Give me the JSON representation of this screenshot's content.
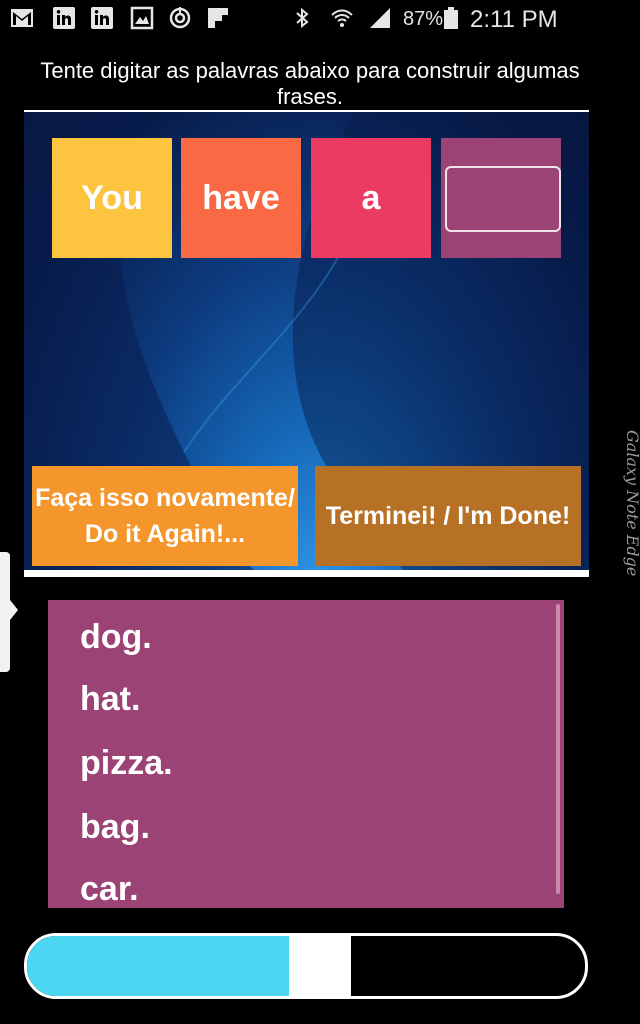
{
  "status_bar": {
    "icons_left": [
      "gmail-icon",
      "linkedin-icon",
      "linkedin-icon",
      "gallery-icon",
      "sync-icon",
      "flipboard-icon"
    ],
    "icons_right": [
      "bluetooth-icon",
      "wifi-icon",
      "signal-icon",
      "battery-icon"
    ],
    "battery": "87%",
    "time": "2:11 PM"
  },
  "instruction": "Tente digitar as palavras abaixo para construir algumas frases.",
  "sentence": {
    "words": [
      {
        "text": "You",
        "color": "#fdc43f"
      },
      {
        "text": "have",
        "color": "#f96a44"
      },
      {
        "text": "a",
        "color": "#eb3b62"
      }
    ],
    "blank_color": "#9c4375",
    "blank_value": ""
  },
  "buttons": {
    "again": "Faça isso novamente/ Do it Again!...",
    "done": "Terminei! / I'm Done!"
  },
  "word_list": [
    "dog.",
    "hat.",
    "pizza.",
    "bag.",
    "car."
  ],
  "progress": {
    "fraction": 0.47,
    "color": "#4bd6f2"
  },
  "device_label": "Galaxy Note Edge"
}
